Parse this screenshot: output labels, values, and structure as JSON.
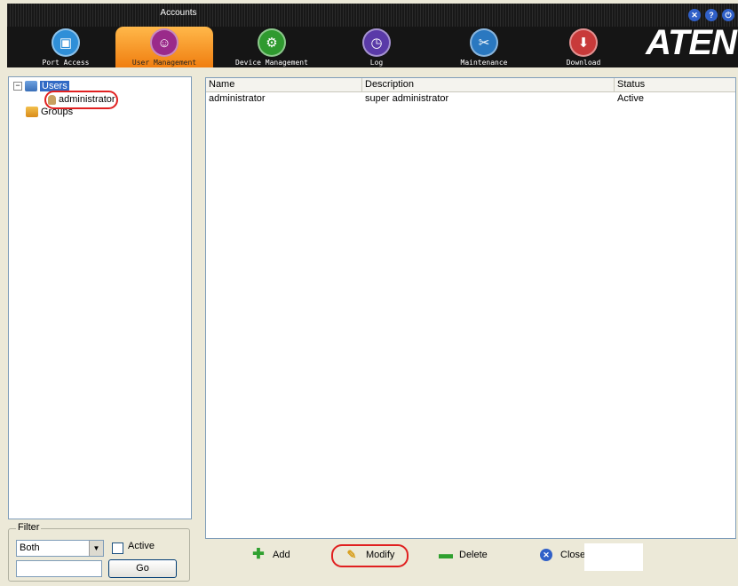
{
  "header": {
    "subtitle": "Accounts",
    "brand": "ATEN",
    "tabs": [
      {
        "label": "Port Access",
        "icon": "port-access-icon",
        "color": "#2f8fd8",
        "glyph": "▣"
      },
      {
        "label": "User Management",
        "icon": "users-icon",
        "color": "#9a2a8a",
        "glyph": "☺"
      },
      {
        "label": "Device Management",
        "icon": "device-icon",
        "color": "#2f9a2f",
        "glyph": "⚙"
      },
      {
        "label": "Log",
        "icon": "log-clock-icon",
        "color": "#5a3aa8",
        "glyph": "◷"
      },
      {
        "label": "Maintenance",
        "icon": "maintenance-icon",
        "color": "#2a78c0",
        "glyph": "✂"
      },
      {
        "label": "Download",
        "icon": "download-icon",
        "color": "#c83a3a",
        "glyph": "⬇"
      }
    ],
    "window_controls": [
      {
        "icon": "close-icon",
        "glyph": "✕"
      },
      {
        "icon": "help-icon",
        "glyph": "?"
      },
      {
        "icon": "logout-icon",
        "glyph": "⏻"
      }
    ]
  },
  "tree": {
    "users_label": "Users",
    "administrator_label": "administrator",
    "groups_label": "Groups"
  },
  "table": {
    "columns": [
      "Name",
      "Description",
      "Status"
    ],
    "rows": [
      {
        "name": "administrator",
        "description": "super administrator",
        "status": "Active"
      }
    ]
  },
  "filter": {
    "legend": "Filter",
    "select_value": "Both",
    "active_label": "Active",
    "text_value": "",
    "go_label": "Go"
  },
  "actions": {
    "add": "Add",
    "modify": "Modify",
    "delete": "Delete",
    "close": "Close"
  },
  "colors": {
    "active_tab": "#f09a20",
    "highlight_oval": "#e02020",
    "selection": "#316ac5"
  }
}
